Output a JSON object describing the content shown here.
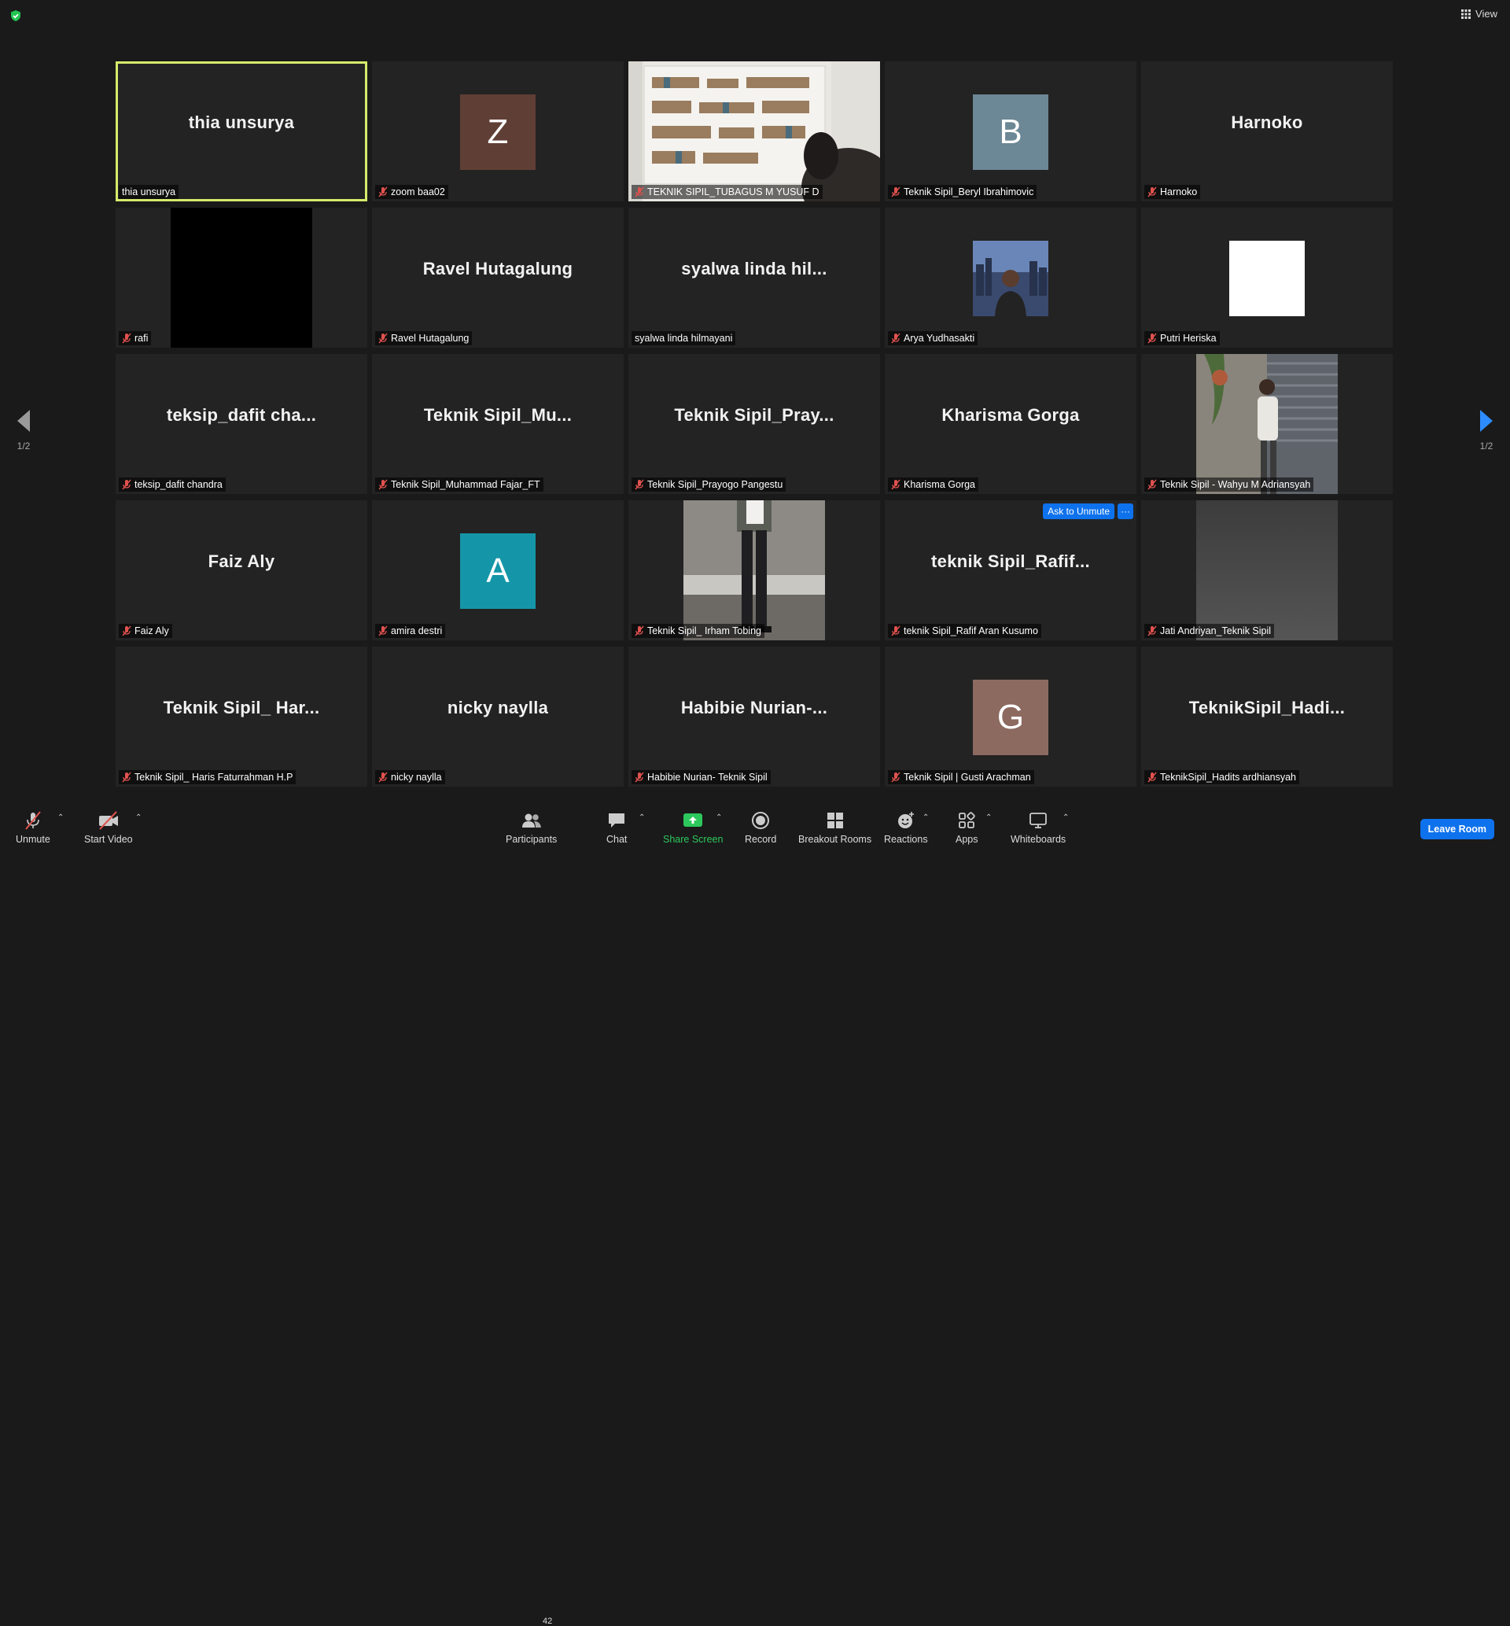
{
  "top": {
    "view_label": "View"
  },
  "tiles": [
    {
      "display": "thia unsurya",
      "label": "thia unsurya"
    },
    {
      "initial": "Z",
      "label": "zoom baa02",
      "color": "#5f3f35"
    },
    {
      "label": "TEKNIK SIPIL_TUBAGUS M YUSUF D"
    },
    {
      "initial": "B",
      "label": "Teknik Sipil_Beryl Ibrahimovic",
      "color": "#6c8795"
    },
    {
      "display": "Harnoko",
      "label": "Harnoko"
    },
    {
      "label": "rafi"
    },
    {
      "display": "Ravel Hutagalung",
      "label": "Ravel Hutagalung"
    },
    {
      "display": "syalwa linda hil...",
      "label": "syalwa linda hilmayani"
    },
    {
      "label": "Arya Yudhasakti"
    },
    {
      "label": "Putri Heriska"
    },
    {
      "display": "teksip_dafit cha...",
      "label": "teksip_dafit chandra"
    },
    {
      "display": "Teknik Sipil_Mu...",
      "label": "Teknik Sipil_Muhammad Fajar_FT"
    },
    {
      "display": "Teknik Sipil_Pray...",
      "label": "Teknik Sipil_Prayogo Pangestu"
    },
    {
      "display": "Kharisma Gorga",
      "label": "Kharisma Gorga"
    },
    {
      "label": "Teknik Sipil - Wahyu M Adriansyah"
    },
    {
      "display": "Faiz Aly",
      "label": "Faiz Aly"
    },
    {
      "initial": "A",
      "label": "amira destri",
      "color": "#1496a8"
    },
    {
      "label": "Teknik Sipil_ Irham Tobing"
    },
    {
      "display": "teknik Sipil_Rafif...",
      "label": "teknik Sipil_Rafif Aran Kusumo",
      "ask_unmute": "Ask to Unmute",
      "more": "···"
    },
    {
      "label": "Jati Andriyan_Teknik Sipil"
    },
    {
      "display": "Teknik Sipil_ Har...",
      "label": "Teknik Sipil_ Haris Faturrahman H.P"
    },
    {
      "display": "nicky naylla",
      "label": "nicky naylla"
    },
    {
      "display": "Habibie Nurian-...",
      "label": "Habibie Nurian- Teknik Sipil"
    },
    {
      "initial": "G",
      "label": "Teknik Sipil | Gusti Arachman",
      "color": "#8c6a60"
    },
    {
      "display": "TeknikSipil_Hadi...",
      "label": "TeknikSipil_Hadits ardhiansyah"
    }
  ],
  "pagination": {
    "left": "1/2",
    "right": "1/2"
  },
  "toolbar": {
    "unmute": "Unmute",
    "start_video": "Start Video",
    "participants": "Participants",
    "participant_count": "42",
    "chat": "Chat",
    "share_screen": "Share Screen",
    "record": "Record",
    "breakout_rooms": "Breakout Rooms",
    "reactions": "Reactions",
    "apps": "Apps",
    "whiteboards": "Whiteboards",
    "leave_room": "Leave Room"
  }
}
